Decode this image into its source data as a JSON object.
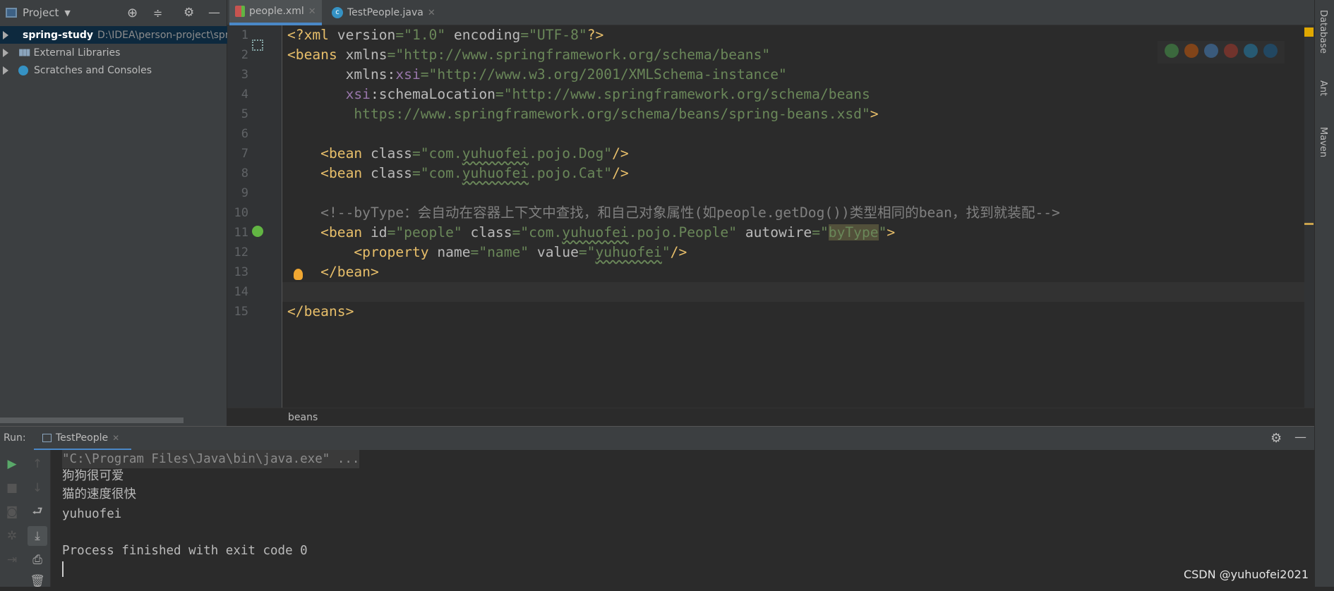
{
  "project_panel": {
    "title": "Project",
    "tree": [
      {
        "label": "spring-study",
        "path": "D:\\IDEA\\person-project\\spring-study",
        "selected": true,
        "icon": "module-folder-icon"
      },
      {
        "label": "External Libraries",
        "icon": "libraries-icon"
      },
      {
        "label": "Scratches and Consoles",
        "icon": "scratches-icon"
      }
    ]
  },
  "tabs": [
    {
      "label": "people.xml",
      "active": true,
      "icon": "xml-spring-file-icon"
    },
    {
      "label": "TestPeople.java",
      "active": false,
      "icon": "java-class-icon"
    }
  ],
  "editor": {
    "current_line": 14,
    "lines": [
      [
        {
          "t": "<?xml ",
          "c": "tag"
        },
        {
          "t": "version",
          "c": "attr"
        },
        {
          "t": "=\"1.0\" ",
          "c": "val"
        },
        {
          "t": "encoding",
          "c": "attr"
        },
        {
          "t": "=\"UTF-8\"",
          "c": "val"
        },
        {
          "t": "?>",
          "c": "tag"
        }
      ],
      [
        {
          "t": "<beans ",
          "c": "tag"
        },
        {
          "t": "xmlns",
          "c": "attr"
        },
        {
          "t": "=\"http://www.springframework.org/schema/beans\"",
          "c": "val"
        }
      ],
      [
        {
          "t": "       xmlns:",
          "c": "attr"
        },
        {
          "t": "xsi",
          "c": "ns"
        },
        {
          "t": "=\"http://www.w3.org/2001/XMLSchema-instance\"",
          "c": "val"
        }
      ],
      [
        {
          "t": "       "
        },
        {
          "t": "xsi",
          "c": "ns"
        },
        {
          "t": ":schemaLocation",
          "c": "attr"
        },
        {
          "t": "=\"http://www.springframework.org/schema/beans",
          "c": "val"
        }
      ],
      [
        {
          "t": "        https://www.springframework.org/schema/beans/spring-beans.xsd\"",
          "c": "val"
        },
        {
          "t": ">",
          "c": "tag"
        }
      ],
      [],
      [
        {
          "t": "    <bean ",
          "c": "tag"
        },
        {
          "t": "class",
          "c": "attr"
        },
        {
          "t": "=\"com.",
          "c": "val"
        },
        {
          "t": "yuhuofei",
          "c": "val sq"
        },
        {
          "t": ".pojo.Dog\"",
          "c": "val"
        },
        {
          "t": "/>",
          "c": "tag"
        }
      ],
      [
        {
          "t": "    <bean ",
          "c": "tag"
        },
        {
          "t": "class",
          "c": "attr"
        },
        {
          "t": "=\"com.",
          "c": "val"
        },
        {
          "t": "yuhuofei",
          "c": "val sq"
        },
        {
          "t": ".pojo.Cat\"",
          "c": "val"
        },
        {
          "t": "/>",
          "c": "tag"
        }
      ],
      [],
      [
        {
          "t": "    <!--byType：会自动在容器上下文中查找，和自己对象属性(如people.getDog())类型相同的bean，找到就装配-->",
          "c": "cm"
        }
      ],
      [
        {
          "t": "    <bean ",
          "c": "tag"
        },
        {
          "t": "id",
          "c": "attr"
        },
        {
          "t": "=\"people\" ",
          "c": "val"
        },
        {
          "t": "class",
          "c": "attr"
        },
        {
          "t": "=\"com.",
          "c": "val"
        },
        {
          "t": "yuhuofei",
          "c": "val sq"
        },
        {
          "t": ".pojo.People\" ",
          "c": "val"
        },
        {
          "t": "autowire",
          "c": "attr"
        },
        {
          "t": "=\"",
          "c": "val"
        },
        {
          "t": "byType",
          "c": "val hl"
        },
        {
          "t": "\"",
          "c": "val"
        },
        {
          "t": ">",
          "c": "tag"
        }
      ],
      [
        {
          "t": "        <property ",
          "c": "tag"
        },
        {
          "t": "name",
          "c": "attr"
        },
        {
          "t": "=\"name\" ",
          "c": "val"
        },
        {
          "t": "value",
          "c": "attr"
        },
        {
          "t": "=\"",
          "c": "val"
        },
        {
          "t": "yuhuofei",
          "c": "val sq"
        },
        {
          "t": "\"",
          "c": "val"
        },
        {
          "t": "/>",
          "c": "tag"
        }
      ],
      [
        {
          "t": "    </bean>",
          "c": "tag"
        }
      ],
      [],
      [
        {
          "t": "</beans>",
          "c": "tag"
        }
      ]
    ]
  },
  "breadcrumb": "beans",
  "run": {
    "label": "Run:",
    "tab": "TestPeople",
    "output": [
      "\"C:\\Program Files\\Java\\bin\\java.exe\" ...",
      "狗狗很可爱",
      "猫的速度很快",
      "yuhuofei",
      "",
      "Process finished with exit code 0"
    ]
  },
  "right_tools": [
    "Database",
    "Ant",
    "Maven"
  ],
  "watermark": "CSDN @yuhuofei2021"
}
